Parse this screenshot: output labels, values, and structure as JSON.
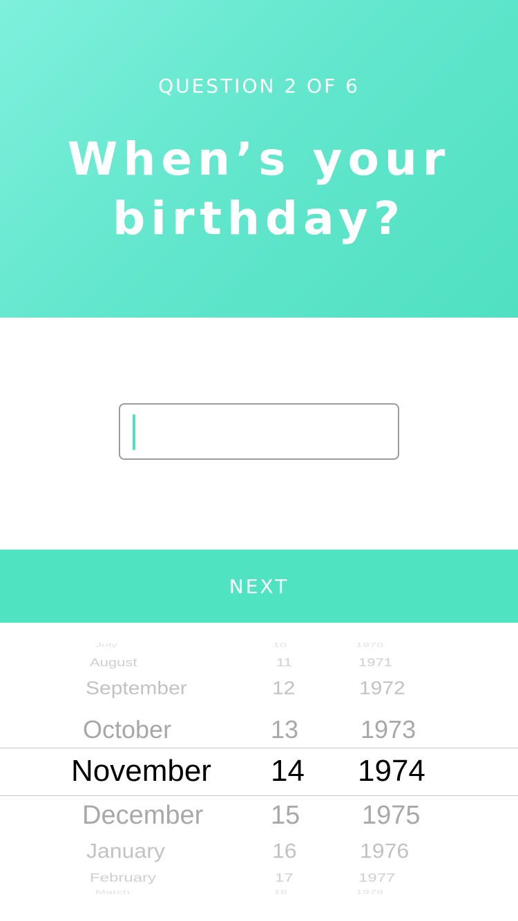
{
  "header": {
    "counter": "QUESTION 2 OF 6",
    "title_line1": "When’s your",
    "title_line2": "birthday?"
  },
  "input": {
    "value": ""
  },
  "next_button": {
    "label": "NEXT"
  },
  "picker": {
    "rows": [
      {
        "month": "July",
        "day": "10",
        "year": "1970"
      },
      {
        "month": "August",
        "day": "11",
        "year": "1971"
      },
      {
        "month": "September",
        "day": "12",
        "year": "1972"
      },
      {
        "month": "October",
        "day": "13",
        "year": "1973"
      },
      {
        "month": "November",
        "day": "14",
        "year": "1974"
      },
      {
        "month": "December",
        "day": "15",
        "year": "1975"
      },
      {
        "month": "January",
        "day": "16",
        "year": "1976"
      },
      {
        "month": "February",
        "day": "17",
        "year": "1977"
      },
      {
        "month": "March",
        "day": "18",
        "year": "1978"
      }
    ],
    "selected": {
      "month": "November",
      "day": "14",
      "year": "1974"
    }
  },
  "colors": {
    "accent": "#50E3C2",
    "header_start": "#7EF0DC",
    "header_end": "#50E0C1"
  }
}
